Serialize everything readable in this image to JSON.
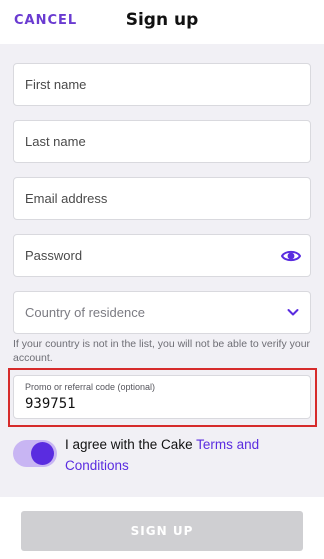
{
  "header": {
    "cancel_label": "CANCEL",
    "title": "Sign up"
  },
  "form": {
    "first_name_placeholder": "First name",
    "last_name_placeholder": "Last name",
    "email_placeholder": "Email address",
    "password_placeholder": "Password",
    "country_placeholder": "Country of residence",
    "country_hint": "If your country is not in the list, you will not be able to verify your account.",
    "promo_label": "Promo or referral code (optional)",
    "promo_value": "939751"
  },
  "terms": {
    "prefix": "I agree with the Cake ",
    "link_text": "Terms and Conditions",
    "toggle_on": true
  },
  "footer": {
    "signup_label": "SIGN UP"
  },
  "icons": {
    "password_toggle": "eye-icon",
    "country_dropdown": "chevron-down-icon"
  },
  "colors": {
    "accent": "#5a2ce0",
    "highlight_frame": "#d62b2b",
    "disabled_button": "#cfcfd2"
  }
}
